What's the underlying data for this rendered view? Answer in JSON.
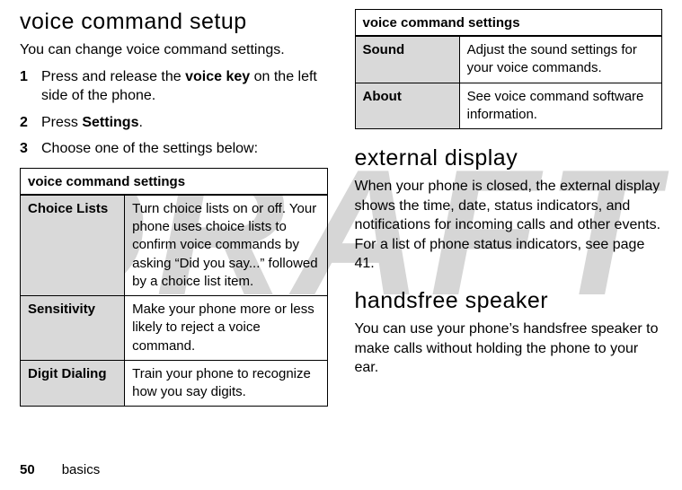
{
  "watermark": "DRAFT",
  "left": {
    "heading": "voice command setup",
    "intro": "You can change voice command settings.",
    "step1_a": "Press and release the ",
    "step1_b": "voice key",
    "step1_c": " on the left side of the phone.",
    "step2_a": "Press ",
    "step2_b": "Settings",
    "step2_c": ".",
    "step3": "Choose one of the settings below:",
    "table_header": "voice command settings",
    "rows": {
      "r0": {
        "label": "Choice Lists",
        "desc": "Turn choice lists on or off. Your phone uses choice lists to confirm voice commands by asking “Did you say...” followed by a choice list item."
      },
      "r1": {
        "label": "Sensitivity",
        "desc": "Make your phone more or less likely to reject a voice command."
      },
      "r2": {
        "label": "Digit Dialing",
        "desc": "Train your phone to recognize how you say digits."
      }
    }
  },
  "right": {
    "table_header": "voice command settings",
    "rows": {
      "r0": {
        "label": "Sound",
        "desc": "Adjust the sound settings for your voice commands."
      },
      "r1": {
        "label": "About",
        "desc": "See voice command software information."
      }
    },
    "h_ext": "external display",
    "p_ext": "When your phone is closed, the external display shows the time, date, status indicators, and notifications for incoming calls and other events. For a list of phone status indicators, see page 41.",
    "h_hf": "handsfree speaker",
    "p_hf": "You can use your phone’s handsfree speaker to make calls without holding the phone to your ear."
  },
  "footer": {
    "page": "50",
    "section": "basics"
  }
}
